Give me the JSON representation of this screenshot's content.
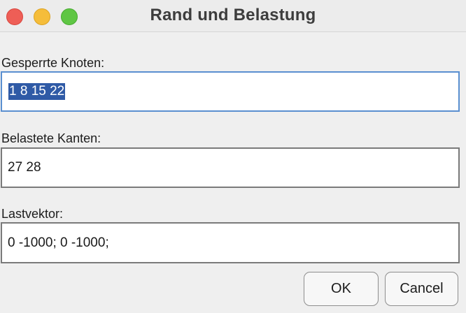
{
  "window": {
    "title": "Rand und Belastung"
  },
  "fields": [
    {
      "label": "Gesperrte Knoten:",
      "value": "1 8 15 22",
      "selected": true
    },
    {
      "label": "Belastete Kanten:",
      "value": "27 28"
    },
    {
      "label": "Lastvektor:",
      "value": "0 -1000; 0 -1000;"
    }
  ],
  "buttons": {
    "ok": "OK",
    "cancel": "Cancel"
  },
  "colors": {
    "selection": "#2f5aa6",
    "focus_border": "#5a8fd0",
    "close": "#ee5e56",
    "minimize": "#f5bd3a",
    "maximize": "#5fc644"
  }
}
